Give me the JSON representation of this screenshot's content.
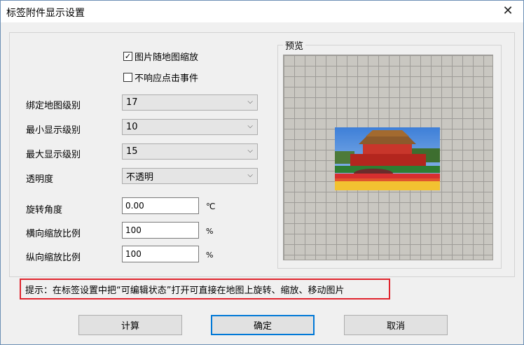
{
  "window": {
    "title": "标签附件显示设置",
    "close_glyph": "✕"
  },
  "options": {
    "scale_with_map": {
      "label": "图片随地图缩放",
      "checked": true
    },
    "ignore_click": {
      "label": "不响应点击事件",
      "checked": false
    }
  },
  "fields": {
    "bind_level": {
      "label": "绑定地图级别",
      "value": "17"
    },
    "min_level": {
      "label": "最小显示级别",
      "value": "10"
    },
    "max_level": {
      "label": "最大显示级别",
      "value": "15"
    },
    "opacity": {
      "label": "透明度",
      "value": "不透明"
    },
    "rotation": {
      "label": "旋转角度",
      "value": "0.00",
      "unit": "℃"
    },
    "h_scale": {
      "label": "横向缩放比例",
      "value": "100",
      "unit": "%"
    },
    "v_scale": {
      "label": "纵向缩放比例",
      "value": "100",
      "unit": "%"
    }
  },
  "preview": {
    "label": "预览"
  },
  "hint": "提示：在标签设置中把“可编辑状态”打开可直接在地图上旋转、缩放、移动图片",
  "buttons": {
    "compute": "计算",
    "ok": "确定",
    "cancel": "取消"
  },
  "colors": {
    "hint_border": "#e0242d",
    "default_button_border": "#0078d7",
    "grid_bg": "#c9c7c1"
  }
}
